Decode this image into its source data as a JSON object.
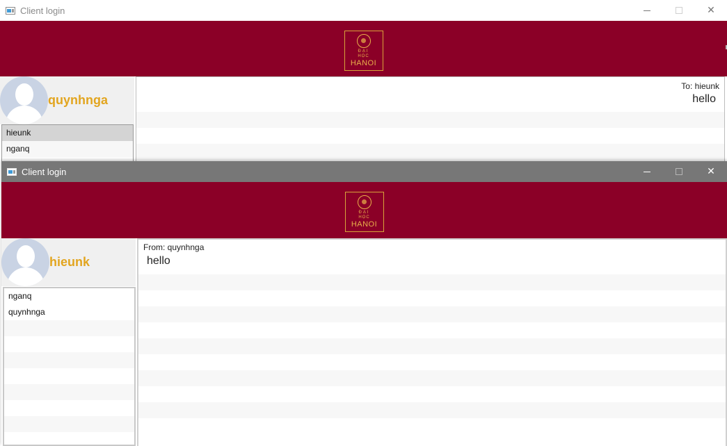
{
  "back_window": {
    "title": "Client login",
    "logo": {
      "line1": "ĐẠI",
      "line2": "HỌC",
      "line3": "HANOI"
    },
    "user": {
      "username": "quynhnga"
    },
    "contacts": [
      "hieunk",
      "nganq"
    ],
    "selected_contact": "hieunk",
    "messages": [
      {
        "meta": "To: hieunk",
        "text": "hello",
        "align": "right"
      }
    ]
  },
  "front_window": {
    "title": "Client login",
    "logo": {
      "line1": "ĐẠI",
      "line2": "HỌC",
      "line3": "HANOI"
    },
    "user": {
      "username": "hieunk"
    },
    "contacts": [
      "nganq",
      "quynhnga"
    ],
    "messages": [
      {
        "meta": "From: quynhnga",
        "text": "hello",
        "align": "left"
      }
    ]
  },
  "colors": {
    "header_band": "#8b0027",
    "username": "#e2a51f",
    "logo_gold": "#e8b04a",
    "selected_row": "#d4d4d4",
    "front_titlebar": "#777777"
  },
  "icons": {
    "app": "window-app-icon",
    "minimize": "minimize-icon",
    "maximize": "maximize-icon",
    "close": "close-icon",
    "avatar": "user-avatar-icon"
  }
}
